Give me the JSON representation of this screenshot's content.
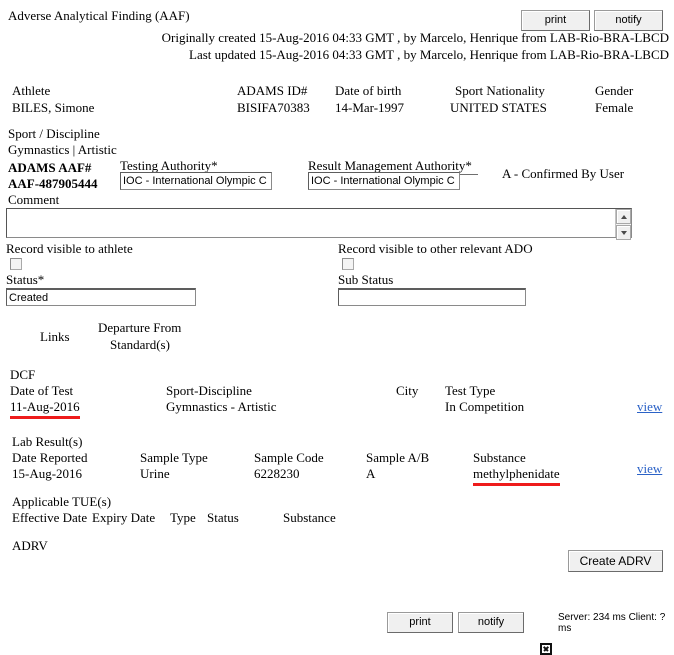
{
  "header": {
    "title": "Adverse Analytical Finding (AAF)",
    "print_label": "print",
    "notify_label": "notify",
    "originally_created": "Originally created 15-Aug-2016 04:33 GMT , by Marcelo, Henrique from LAB-Rio-BRA-LBCD",
    "last_updated": "Last updated 15-Aug-2016 04:33 GMT , by Marcelo, Henrique from LAB-Rio-BRA-LBCD"
  },
  "athlete": {
    "athlete_label": "Athlete",
    "athlete_value": "BILES, Simone",
    "adams_id_label": "ADAMS ID#",
    "adams_id_value": "BISIFA70383",
    "dob_label": "Date of birth",
    "dob_value": "14-Mar-1997",
    "nationality_label": "Sport Nationality",
    "nationality_value": "UNITED STATES",
    "gender_label": "Gender",
    "gender_value": "Female",
    "sport_discipline_label": "Sport / Discipline",
    "sport_discipline_value": "Gymnastics | Artistic"
  },
  "aaf": {
    "aaf_number_label": "ADAMS AAF#",
    "aaf_number_value": "AAF-487905444",
    "testing_authority_label": "Testing Authority*",
    "testing_authority_value": "IOC - International Olympic C",
    "rma_label": "Result Management Authority*",
    "rma_value": "IOC - International Olympic C",
    "confirmation_status": "A - Confirmed By User",
    "comment_label": "Comment",
    "comment_value": ""
  },
  "visibility": {
    "athlete_visible_label": "Record visible to athlete",
    "ado_visible_label": "Record visible to other relevant ADO",
    "athlete_visible_checked": false,
    "ado_visible_checked": false
  },
  "status": {
    "status_label": "Status*",
    "status_value": "Created",
    "sub_status_label": "Sub Status",
    "sub_status_value": ""
  },
  "links_section": {
    "links_label": "Links",
    "departure_label_line1": "Departure From",
    "departure_label_line2": "Standard(s)"
  },
  "dcf": {
    "section_label": "DCF",
    "date_of_test_label": "Date of Test",
    "sport_discipline_label": "Sport-Discipline",
    "city_label": "City",
    "test_type_label": "Test Type",
    "date_of_test_value": "11-Aug-2016",
    "sport_discipline_value": "Gymnastics - Artistic",
    "city_value": "",
    "test_type_value": "In Competition",
    "view_label": "view"
  },
  "lab_results": {
    "section_label": "Lab Result(s)",
    "date_reported_label": "Date Reported",
    "sample_type_label": "Sample Type",
    "sample_code_label": "Sample Code",
    "sample_ab_label": "Sample A/B",
    "substance_label": "Substance",
    "date_reported_value": "15-Aug-2016",
    "sample_type_value": "Urine",
    "sample_code_value": "6228230",
    "sample_ab_value": "A",
    "substance_value": "methylphenidate",
    "view_label": "view"
  },
  "tue": {
    "section_label": "Applicable TUE(s)",
    "effective_date_label": "Effective Date",
    "expiry_date_label": "Expiry Date",
    "type_label": "Type",
    "status_label": "Status",
    "substance_label": "Substance"
  },
  "adrv": {
    "section_label": "ADRV",
    "create_button_label": "Create ADRV"
  },
  "footer": {
    "print_label": "print",
    "notify_label": "notify",
    "status_icon": "error-x-icon",
    "timing_text": "Server: 234 ms Client: ? ms"
  },
  "colors": {
    "link": "#2b62c7",
    "highlight": "#ee1b1b",
    "button_face": "#f0f0f0"
  }
}
